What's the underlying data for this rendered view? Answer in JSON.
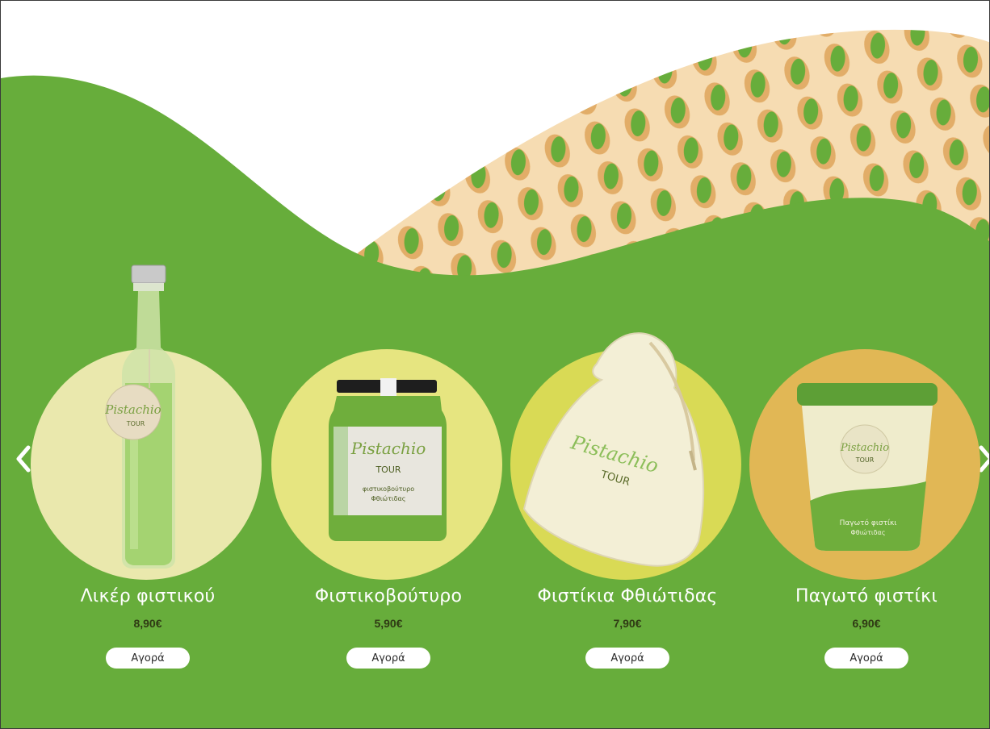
{
  "colors": {
    "green": "#67ad3b",
    "pattern_bg": "#f6dcb2",
    "shell": "#e2ad68",
    "kernel": "#67ad3b"
  },
  "nav": {
    "prev_icon": "chevron-left-icon",
    "next_icon": "chevron-right-icon"
  },
  "products": [
    {
      "name": "Λικέρ φιστικού",
      "price": "8,90€",
      "button": "Αγορά",
      "circle_color": "#eae8ad",
      "icon": "liqueur-bottle-image",
      "label_lines": [
        "Pistachio",
        "TOUR"
      ]
    },
    {
      "name": "Φιστικοβούτυρο",
      "price": "5,90€",
      "button": "Αγορά",
      "circle_color": "#e6e580",
      "icon": "pistachio-butter-jar-image",
      "label_lines": [
        "Pistachio",
        "TOUR",
        "φιστικοβούτυρο",
        "Φθιώτιδας"
      ]
    },
    {
      "name": "Φιστίκια Φθιώτιδας",
      "price": "7,90€",
      "button": "Αγορά",
      "circle_color": "#d9da55",
      "icon": "pistachio-bag-image",
      "label_lines": [
        "Pistachio",
        "TOUR"
      ]
    },
    {
      "name": "Παγωτό φιστίκι",
      "price": "6,90€",
      "button": "Αγορά",
      "circle_color": "#e1b755",
      "icon": "ice-cream-cup-image",
      "label_lines": [
        "Pistachio",
        "TOUR",
        "Παγωτό φιστίκι",
        "Φθιώτιδας"
      ]
    }
  ]
}
